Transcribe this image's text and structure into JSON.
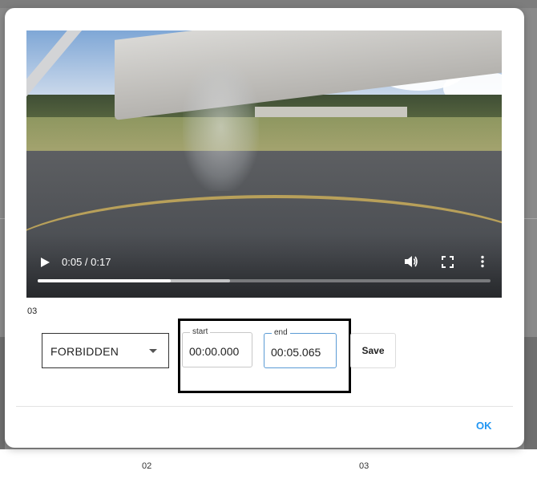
{
  "video": {
    "time_display": "0:05 / 0:17",
    "progress": 0.294,
    "buffered": 0.425
  },
  "clip": {
    "name": "03"
  },
  "category_select": {
    "value": "FORBIDDEN"
  },
  "start_field": {
    "label": "start",
    "value": "00:00.000"
  },
  "end_field": {
    "label": "end",
    "value": "00:05.065"
  },
  "actions": {
    "save_label": "Save",
    "ok_label": "OK"
  },
  "background": {
    "captions": [
      "02",
      "03"
    ]
  },
  "colors": {
    "accent": "#2196f3",
    "focus_border": "#5b9bd5"
  },
  "icons": [
    "play-icon",
    "volume-icon",
    "fullscreen-icon",
    "more-vert-icon",
    "dropdown-caret-icon"
  ]
}
